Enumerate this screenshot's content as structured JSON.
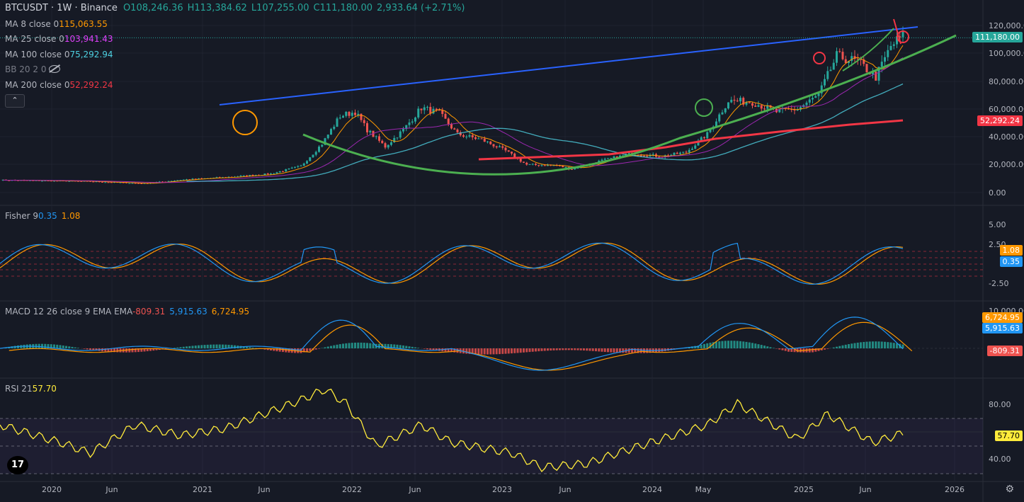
{
  "header": {
    "symbol": "BTCUSDT · 1W · Binance",
    "open": "O108,246.36",
    "high": "H113,384.62",
    "low": "L107,255.00",
    "close": "C111,180.00",
    "change": "2,933.64 (+2.71%)"
  },
  "ma8": {
    "label": "MA 8 close 0",
    "value": "115,063.55",
    "color": "#ff9800"
  },
  "ma25": {
    "label": "MA 25 close 0",
    "value": "103,941.43",
    "color": "#e040fb"
  },
  "ma100": {
    "label": "MA 100 close 0",
    "value": "75,292.94",
    "color": "#4dd0e1"
  },
  "bb": {
    "label": "BB 20 2 0",
    "icon": "eye-hidden-icon"
  },
  "ma200": {
    "label": "MA 200 close 0",
    "value": "52,292.24",
    "color": "#f23645"
  },
  "collapse_icon": "chevron-up-icon",
  "collapse_glyph": "⌃",
  "fisher": {
    "label": "Fisher 9",
    "v1": "0.35",
    "v2": "1.08",
    "c1": "#2196f3",
    "c2": "#ff9800"
  },
  "macd": {
    "label": "MACD 12 26 close 9 EMA EMA",
    "hist": "-809.31",
    "macd": "5,915.63",
    "signal": "6,724.95"
  },
  "rsi": {
    "label": "RSI 21",
    "value": "57.70",
    "color": "#ffeb3b"
  },
  "price_axis": [
    "120,000.00",
    "100,000.00",
    "80,000.00",
    "60,000.00",
    "40,000.00",
    "20,000.00",
    "0.00"
  ],
  "price_badges": {
    "last": "111,180.00",
    "ma200": "52,292.24"
  },
  "fisher_axis": [
    "5.00",
    "2.50",
    "-2.50"
  ],
  "fisher_badges": {
    "v2": "1.08",
    "v1": "0.35"
  },
  "macd_axis": {
    "top": "10,000.00"
  },
  "macd_badges": {
    "signal": "6,724.95",
    "macd": "5,915.63",
    "hist": "-809.31"
  },
  "rsi_axis": [
    "80.00",
    "40.00"
  ],
  "rsi_badge": "57.70",
  "time_axis": [
    "2020",
    "Jun",
    "2021",
    "Jun",
    "2022",
    "Jun",
    "2023",
    "Jun",
    "2024",
    "May",
    "2025",
    "Jun",
    "2026"
  ],
  "logo_text": "17",
  "settings_icon": "gear-icon",
  "settings_glyph": "⚙"
}
